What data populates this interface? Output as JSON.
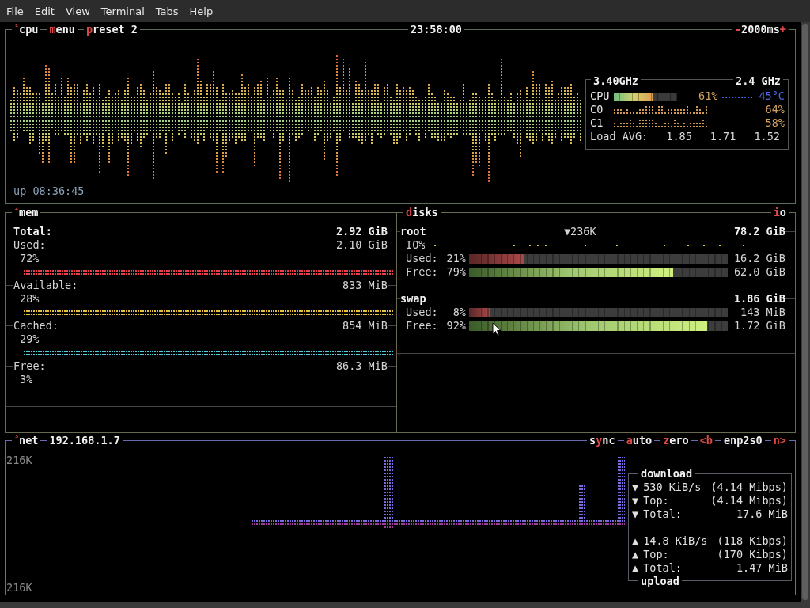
{
  "menu_bar": [
    "File",
    "Edit",
    "View",
    "Terminal",
    "Tabs",
    "Help"
  ],
  "cpu": {
    "title": {
      "number": "¹",
      "label": "cpu"
    },
    "tabs": [
      {
        "parts": [
          {
            "text": "m",
            "hotkey": true
          },
          {
            "text": "enu",
            "hotkey": false
          }
        ]
      },
      {
        "parts": [
          {
            "text": "p",
            "hotkey": true
          },
          {
            "text": "reset 2",
            "hotkey": false
          }
        ]
      }
    ],
    "clock": "23:58:00",
    "interval": {
      "parts": [
        {
          "text": "-",
          "hotkey": true
        },
        {
          "text": "2000ms",
          "hotkey": false
        },
        {
          "text": "+",
          "hotkey": true
        }
      ]
    },
    "uptime": "up 08:36:45",
    "info": {
      "freq": "3.40GHz",
      "max_freq": "2.4 GHz",
      "rows": [
        {
          "kind": "meter",
          "label": "CPU",
          "level": 0.61,
          "percent": "61%",
          "temp": "45°C"
        },
        {
          "kind": "graph",
          "label": "C0",
          "percent": "64%"
        },
        {
          "kind": "graph",
          "label": "C1",
          "percent": "58%"
        }
      ],
      "load": {
        "label": "Load AVG:",
        "values": [
          "1.85",
          "1.71",
          "1.52"
        ]
      }
    }
  },
  "mem": {
    "title": {
      "number": "²",
      "label": "mem"
    },
    "total": {
      "label": "Total:",
      "value": "2.92 GiB"
    },
    "rows": [
      {
        "label": "Used:",
        "value": "2.10 GiB",
        "percent": "72%",
        "color": "#e8404a"
      },
      {
        "label": "Available:",
        "value": "833 MiB",
        "percent": "28%",
        "color": "#e8c040"
      },
      {
        "label": "Cached:",
        "value": "854 MiB",
        "percent": "29%",
        "color": "#50d0e0"
      },
      {
        "label": "Free:",
        "value": "86.3 MiB",
        "percent": "3%"
      }
    ]
  },
  "disks": {
    "title": {
      "parts": [
        {
          "text": "d",
          "hotkey": true
        },
        {
          "text": "isks",
          "hotkey": false
        }
      ]
    },
    "io_toggle": {
      "parts": [
        {
          "text": "i",
          "hotkey": true
        },
        {
          "text": "o",
          "hotkey": false
        }
      ]
    },
    "mounts": [
      {
        "name": "root",
        "io": "▼236K",
        "size": "78.2 GiB",
        "io_label": "IO%",
        "bars": [
          {
            "kind": "used",
            "label": "Used:",
            "percent": "21%",
            "level": 0.21,
            "value": "16.2 GiB"
          },
          {
            "kind": "free",
            "label": "Free:",
            "percent": "79%",
            "level": 0.79,
            "value": "62.0 GiB"
          }
        ]
      },
      {
        "name": "swap",
        "size": "1.86 GiB",
        "bars": [
          {
            "kind": "used",
            "label": "Used:",
            "percent": "8%",
            "level": 0.08,
            "value": "143 MiB"
          },
          {
            "kind": "free",
            "label": "Free:",
            "percent": "92%",
            "level": 0.92,
            "value": "1.72 GiB"
          }
        ]
      }
    ]
  },
  "net": {
    "title": {
      "number": "³",
      "label": "net"
    },
    "address": "192.168.1.7",
    "controls": [
      {
        "parts": [
          {
            "text": "s",
            "hotkey": false
          },
          {
            "text": "y",
            "hotkey": true
          },
          {
            "text": "nc",
            "hotkey": false
          }
        ]
      },
      {
        "parts": [
          {
            "text": "a",
            "hotkey": true
          },
          {
            "text": "uto",
            "hotkey": false
          }
        ]
      },
      {
        "parts": [
          {
            "text": "z",
            "hotkey": true
          },
          {
            "text": "ero",
            "hotkey": false
          }
        ]
      },
      {
        "parts": [
          {
            "text": "<b",
            "hotkey": true
          }
        ]
      },
      {
        "parts": [
          {
            "text": "enp2s0",
            "hotkey": false
          }
        ]
      },
      {
        "parts": [
          {
            "text": "n>",
            "hotkey": true
          }
        ]
      }
    ],
    "scale_top": "216K",
    "scale_bottom": "216K",
    "stats": {
      "download_title": "download",
      "upload_title": "upload",
      "download": [
        {
          "arrow": "▼",
          "label": "530 KiB/s",
          "value": "(4.14 Mibps)"
        },
        {
          "arrow": "▼",
          "label": "Top:",
          "value": "(4.14 Mibps)"
        },
        {
          "arrow": "▼",
          "label": "Total:",
          "value": "17.6 MiB"
        }
      ],
      "upload": [
        {
          "arrow": "▲",
          "label": "14.8 KiB/s",
          "value": "(118 Kibps)"
        },
        {
          "arrow": "▲",
          "label": "Top:",
          "value": "(170 Kibps)"
        },
        {
          "arrow": "▲",
          "label": "Total:",
          "value": "1.47 MiB"
        }
      ]
    }
  }
}
